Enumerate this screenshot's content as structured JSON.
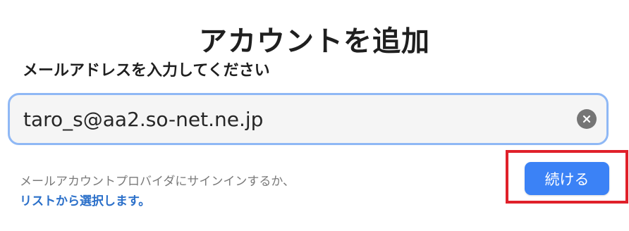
{
  "dialog": {
    "title": "アカウントを追加",
    "prompt": "メールアドレスを入力してください"
  },
  "email": {
    "value": "taro_s@aa2.so-net.ne.jp",
    "clear_icon": "clear-circle-x-icon"
  },
  "provider": {
    "text": "メールアカウントプロバイダにサインインするか、",
    "link": "リストから選択します。"
  },
  "actions": {
    "continue_label": "続ける"
  },
  "colors": {
    "accent": "#3b82f6",
    "link": "#2a6fc9",
    "highlight": "#e0202a",
    "field_border": "#8fb8f5"
  }
}
